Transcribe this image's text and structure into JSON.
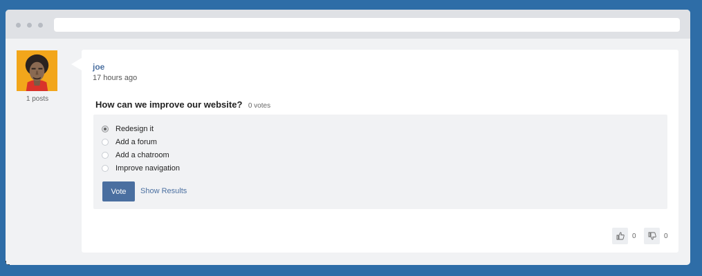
{
  "colors": {
    "page_background": "#2e6da7",
    "accent": "#4a6fa0"
  },
  "author": {
    "post_count": "1 posts",
    "avatar_icon": "avatar-illustration"
  },
  "post": {
    "username": "joe",
    "timestamp": "17 hours ago",
    "poll": {
      "question": "How can we improve our website?",
      "votes": "0 votes",
      "options": [
        {
          "label": "Redesign it",
          "selected": true
        },
        {
          "label": "Add a forum",
          "selected": false
        },
        {
          "label": "Add a chatroom",
          "selected": false
        },
        {
          "label": "Improve navigation",
          "selected": false
        }
      ],
      "vote_label": "Vote",
      "show_results_label": "Show Results"
    },
    "reactions": {
      "like_icon": "thumbs-up-icon",
      "like_count": "0",
      "dislike_icon": "thumbs-down-icon",
      "dislike_count": "0"
    }
  }
}
